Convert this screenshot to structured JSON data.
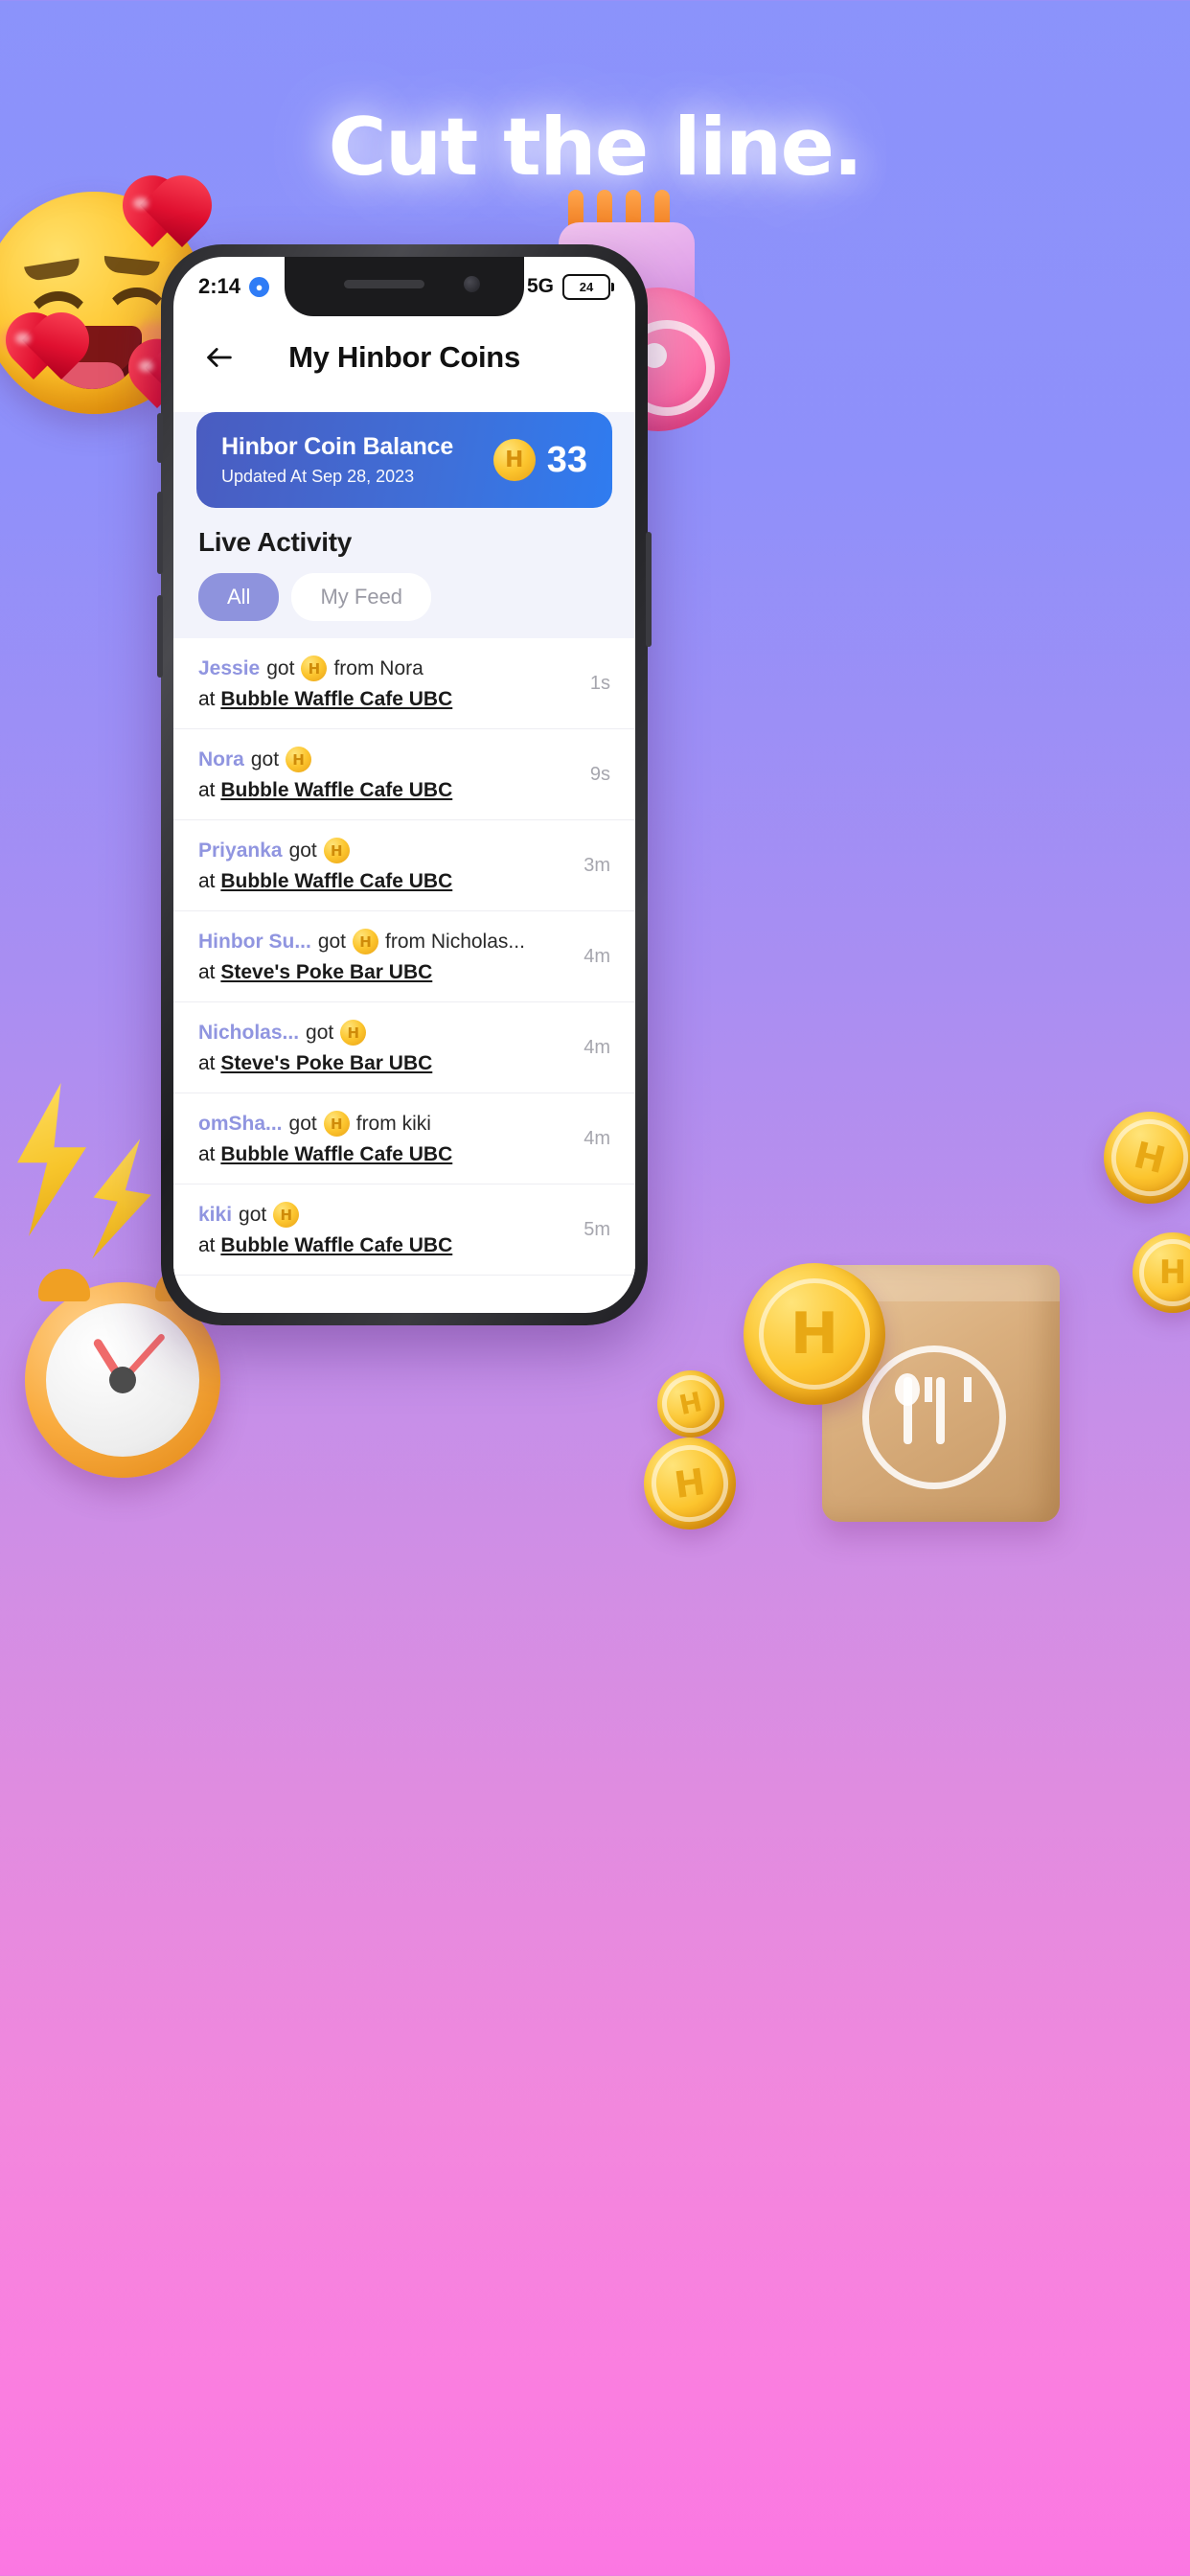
{
  "promo": {
    "headline": "Cut the line."
  },
  "phone": {
    "status": {
      "time": "2:14",
      "network": "5G",
      "battery": "24",
      "badge_icon": "chat-icon"
    },
    "header": {
      "title": "My Hinbor Coins",
      "back_icon": "back-arrow-icon"
    },
    "balance": {
      "title": "Hinbor Coin Balance",
      "updated": "Updated At Sep 28, 2023",
      "amount": "33",
      "coin_icon": "hinbor-coin-icon",
      "coin_glyph": "H"
    },
    "section": {
      "title": "Live Activity"
    },
    "tabs": [
      {
        "label": "All",
        "active": true
      },
      {
        "label": "My Feed",
        "active": false
      }
    ],
    "activity": [
      {
        "who": "Jessie",
        "verb": "got",
        "from": "from Nora",
        "venue_prefix": "at ",
        "venue": "Bubble Waffle Cafe UBC",
        "time": "1s"
      },
      {
        "who": "Nora",
        "verb": "got",
        "from": "",
        "venue_prefix": "at ",
        "venue": "Bubble Waffle Cafe UBC",
        "time": "9s"
      },
      {
        "who": "Priyanka",
        "verb": "got",
        "from": "",
        "venue_prefix": "at ",
        "venue": "Bubble Waffle Cafe UBC",
        "time": "3m"
      },
      {
        "who": "Hinbor Su...",
        "verb": "got",
        "from": "from Nicholas...",
        "venue_prefix": "at ",
        "venue": "Steve's Poke Bar UBC",
        "time": "4m"
      },
      {
        "who": "Nicholas...",
        "verb": "got",
        "from": "",
        "venue_prefix": "at ",
        "venue": "Steve's Poke Bar UBC",
        "time": "4m"
      },
      {
        "who": "omSha...",
        "verb": "got",
        "from": "from kiki",
        "venue_prefix": "at ",
        "venue": "Bubble Waffle Cafe UBC",
        "time": "4m"
      },
      {
        "who": "kiki",
        "verb": "got",
        "from": "",
        "venue_prefix": "at ",
        "venue": "Bubble Waffle Cafe UBC",
        "time": "5m"
      }
    ]
  },
  "decor": {
    "coin_glyph": "H",
    "props": [
      "smiling-face-emoji",
      "heart-emoji",
      "bell-emoji",
      "notification-emoji",
      "lightning-bolt-emoji",
      "alarm-clock-emoji",
      "takeout-bag-emoji",
      "gold-coin-emoji"
    ]
  },
  "colors": {
    "accent_periwinkle": "#8e93dd",
    "card_blue_start": "#4a5cc0",
    "card_blue_end": "#2f7cf0",
    "coin_gold": "#fcc52e",
    "bg_top": "#8b93fb",
    "bg_bottom": "#fb77e2"
  }
}
